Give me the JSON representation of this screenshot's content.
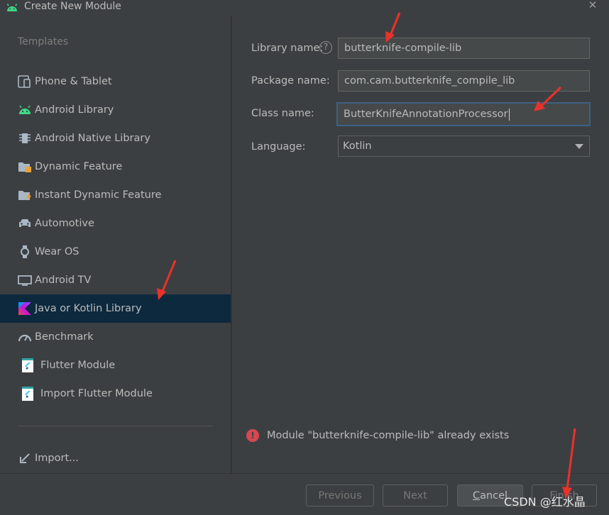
{
  "window": {
    "title": "Create New Module",
    "close_glyph": "✕"
  },
  "templates": {
    "heading": "Templates",
    "items": [
      {
        "label": "Phone & Tablet",
        "icon": "phone-tablet-icon"
      },
      {
        "label": "Android Library",
        "icon": "android-icon"
      },
      {
        "label": "Android Native Library",
        "icon": "native-chip-icon"
      },
      {
        "label": "Dynamic Feature",
        "icon": "folder-feature-icon"
      },
      {
        "label": "Instant Dynamic Feature",
        "icon": "folder-instant-icon"
      },
      {
        "label": "Automotive",
        "icon": "car-icon"
      },
      {
        "label": "Wear OS",
        "icon": "watch-icon"
      },
      {
        "label": "Android TV",
        "icon": "tv-icon"
      },
      {
        "label": "Java or Kotlin Library",
        "icon": "kotlin-icon",
        "selected": true
      },
      {
        "label": "Benchmark",
        "icon": "gauge-icon"
      },
      {
        "label": "Flutter Module",
        "icon": "flutter-icon"
      },
      {
        "label": "Import Flutter Module",
        "icon": "flutter-icon"
      }
    ],
    "import_label": "Import..."
  },
  "form": {
    "library_name_label": "Library name:",
    "library_name_value": "butterknife-compile-lib",
    "help_glyph": "?",
    "package_name_label": "Package name:",
    "package_name_value": "com.cam.butterknife_compile_lib",
    "class_name_label": "Class name:",
    "class_name_value": "ButterKnifeAnnotationProcessor",
    "language_label": "Language:",
    "language_value": "Kotlin"
  },
  "error": {
    "glyph": "!",
    "message": "Module \"butterknife-compile-lib\" already exists"
  },
  "buttons": {
    "previous": "Previous",
    "next": "Next",
    "cancel_u": "C",
    "cancel_rest": "ancel",
    "finish": "Finish"
  },
  "watermark": "CSDN @红水晶",
  "colors": {
    "background": "#3c3f41",
    "selection": "#0d293e",
    "focus_border": "#3d6185",
    "error": "#d6484f",
    "annotation_arrow": "#e8322a"
  }
}
